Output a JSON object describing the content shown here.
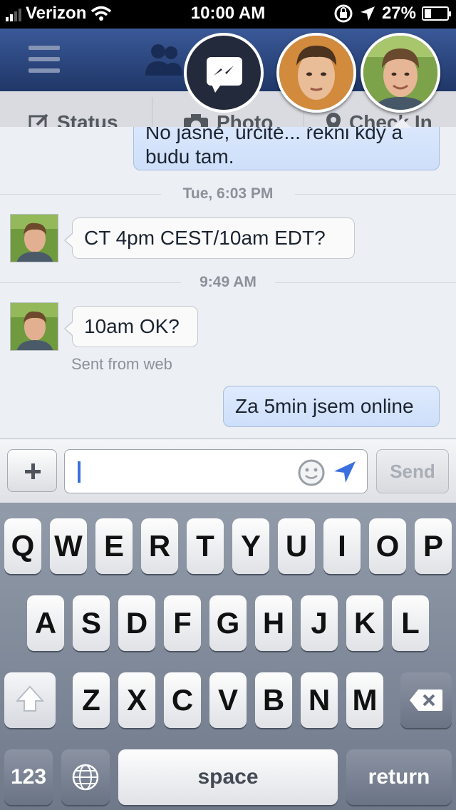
{
  "status_bar": {
    "carrier": "Verizon",
    "time": "10:00 AM",
    "battery": "27%",
    "battery_level": 0.27
  },
  "header": {
    "icons": [
      "menu-icon",
      "friend-requests-icon",
      "messages-icon"
    ]
  },
  "subtabs": [
    {
      "label": "Status",
      "icon": "edit-icon"
    },
    {
      "label": "Photo",
      "icon": "camera-icon"
    },
    {
      "label": "Check In",
      "icon": "location-pin-icon"
    }
  ],
  "chat": {
    "messages": [
      {
        "type": "out",
        "text_top": "No jasně, určitě... řekni kdy a",
        "text": "budu tam."
      },
      {
        "type": "time",
        "text": "Tue, 6:03 PM"
      },
      {
        "type": "in",
        "text": "CT 4pm CEST/10am EDT?"
      },
      {
        "type": "time",
        "text": "9:49 AM"
      },
      {
        "type": "in",
        "text": "10am OK?",
        "meta": "Sent from web"
      },
      {
        "type": "out",
        "text": "Za 5min jsem online"
      }
    ]
  },
  "composer": {
    "input_value": "",
    "send_label": "Send"
  },
  "keyboard": {
    "row1": [
      "Q",
      "W",
      "E",
      "R",
      "T",
      "Y",
      "U",
      "I",
      "O",
      "P"
    ],
    "row2": [
      "A",
      "S",
      "D",
      "F",
      "G",
      "H",
      "J",
      "K",
      "L"
    ],
    "row3": [
      "Z",
      "X",
      "C",
      "V",
      "B",
      "N",
      "M"
    ],
    "numbers_label": "123",
    "space_label": "space",
    "return_label": "return"
  },
  "colors": {
    "header": "#3b5998",
    "outgoing_bubble": "#d6e4fb",
    "chat_bg": "#eceff4",
    "cursor": "#3b6fe0"
  }
}
